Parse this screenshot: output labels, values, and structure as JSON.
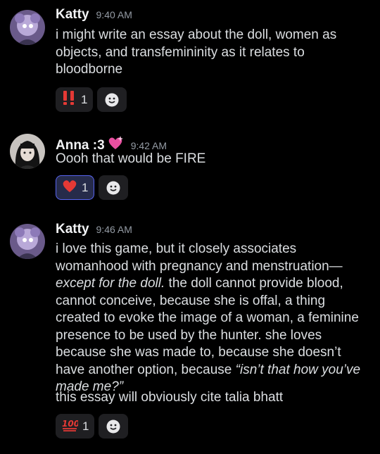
{
  "messages": [
    {
      "author": "Katty",
      "timestamp": "9:40 AM",
      "text": "i might write an essay about the doll, women as objects, and transfemininity as it relates to bloodborne",
      "reaction": {
        "emoji": "!!",
        "count": "1"
      }
    },
    {
      "author": "Anna :3",
      "timestamp": "9:42 AM",
      "text": "Oooh that would be FIRE",
      "reaction": {
        "emoji": "heart",
        "count": "1"
      }
    },
    {
      "author": "Katty",
      "timestamp": "9:46 AM",
      "text_part1": "i love this game, but it closely associates womanhood with pregnancy and menstruation— ",
      "text_italic1": "except for the doll.",
      "text_part2": " the doll cannot provide blood, cannot conceive, because she is offal, a thing created to evoke the image of a woman, a feminine presence to be used by the hunter. she loves because she was made to, because she doesn’t have another option, because ",
      "text_italic2": "“isn’t that how you’ve made me?”",
      "text2": "this essay will obviously cite talia bhatt",
      "reaction": {
        "emoji": "100",
        "count": "1"
      }
    }
  ],
  "colors": {
    "background": "#000000",
    "active_reaction": "#5865f2",
    "text": "#dbdee1"
  },
  "icons": [
    "add-reaction-icon",
    "double-exclamation-emoji",
    "red-heart-emoji",
    "hundred-points-emoji",
    "sparkling-heart-emoji"
  ]
}
